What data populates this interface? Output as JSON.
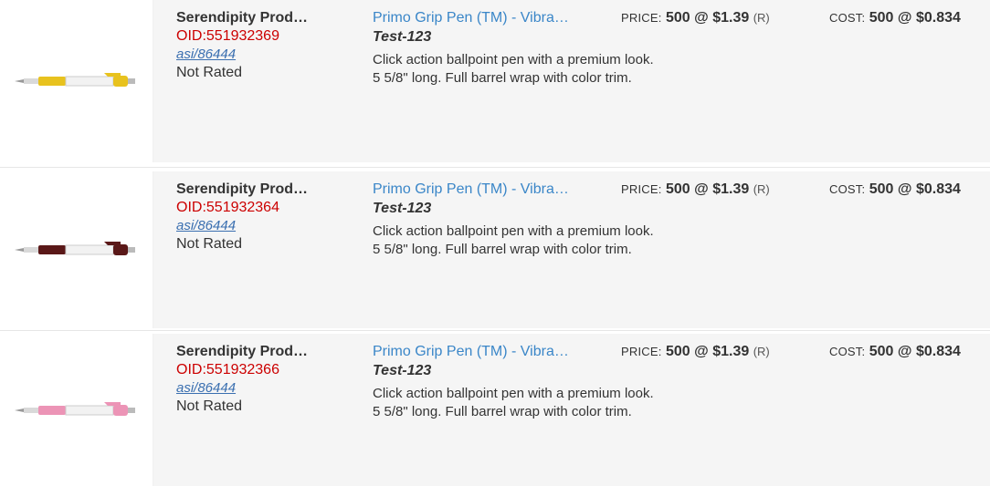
{
  "products": [
    {
      "supplier": "Serendipity Prod…",
      "oid": "OID:551932369",
      "asi": "asi/86444",
      "rating": "Not Rated",
      "name": "Primo Grip Pen (TM) - Vibra…",
      "number": "Test-123",
      "description": "Click action ballpoint pen with a premium look. 5 5/8\" long. Full barrel wrap with color trim.",
      "price_label": "PRICE:",
      "price_qty": "500",
      "price_at": "@",
      "price_value": "$1.39",
      "price_code": "(R)",
      "cost_label": "COST:",
      "cost_qty": "500",
      "cost_at": "@",
      "cost_value": "$0.834",
      "pen_color": "#e8c21e"
    },
    {
      "supplier": "Serendipity Prod…",
      "oid": "OID:551932364",
      "asi": "asi/86444",
      "rating": "Not Rated",
      "name": "Primo Grip Pen (TM) - Vibra…",
      "number": "Test-123",
      "description": "Click action ballpoint pen with a premium look. 5 5/8\" long. Full barrel wrap with color trim.",
      "price_label": "PRICE:",
      "price_qty": "500",
      "price_at": "@",
      "price_value": "$1.39",
      "price_code": "(R)",
      "cost_label": "COST:",
      "cost_qty": "500",
      "cost_at": "@",
      "cost_value": "$0.834",
      "pen_color": "#5a1818"
    },
    {
      "supplier": "Serendipity Prod…",
      "oid": "OID:551932366",
      "asi": "asi/86444",
      "rating": "Not Rated",
      "name": "Primo Grip Pen (TM) - Vibra…",
      "number": "Test-123",
      "description": "Click action ballpoint pen with a premium look. 5 5/8\" long. Full barrel wrap with color trim.",
      "price_label": "PRICE:",
      "price_qty": "500",
      "price_at": "@",
      "price_value": "$1.39",
      "price_code": "(R)",
      "cost_label": "COST:",
      "cost_qty": "500",
      "cost_at": "@",
      "cost_value": "$0.834",
      "pen_color": "#ec94b6"
    }
  ]
}
